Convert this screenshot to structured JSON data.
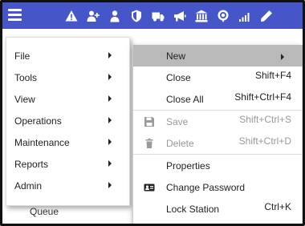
{
  "colors": {
    "topbar": "#4656c9",
    "highlight": "#b9b9b9",
    "disabled_text": "#999999"
  },
  "topbar": {
    "menu_icon": "hamburger-icon",
    "icons": [
      "warning-icon",
      "add-user-icon",
      "user-icon",
      "shield-icon",
      "truck-icon",
      "megaphone-icon",
      "bank-icon",
      "location-pin-icon",
      "signal-icon",
      "pencil-icon"
    ]
  },
  "background": {
    "queue_label": "Queue"
  },
  "main_menu": {
    "items": [
      {
        "label": "File"
      },
      {
        "label": "Tools"
      },
      {
        "label": "View"
      },
      {
        "label": "Operations"
      },
      {
        "label": "Maintenance"
      },
      {
        "label": "Reports"
      },
      {
        "label": "Admin"
      }
    ]
  },
  "file_menu": {
    "items": [
      {
        "label": "New",
        "shortcut": "",
        "icon": "",
        "disabled": false,
        "highlighted": true,
        "submenu": true
      },
      {
        "label": "Close",
        "shortcut": "Shift+F4",
        "icon": "",
        "disabled": false
      },
      {
        "label": "Close All",
        "shortcut": "Shift+Ctrl+F4",
        "icon": "",
        "disabled": false
      },
      {
        "label": "Save",
        "shortcut": "Shift+Ctrl+S",
        "icon": "save-icon",
        "disabled": true
      },
      {
        "label": "Delete",
        "shortcut": "Shift+Ctrl+D",
        "icon": "trash-icon",
        "disabled": true
      },
      {
        "label": "Properties",
        "shortcut": "",
        "icon": "",
        "disabled": false
      },
      {
        "label": "Change Password",
        "shortcut": "",
        "icon": "id-card-icon",
        "disabled": false
      },
      {
        "label": "Lock Station",
        "shortcut": "Ctrl+K",
        "icon": "",
        "disabled": false
      }
    ]
  }
}
